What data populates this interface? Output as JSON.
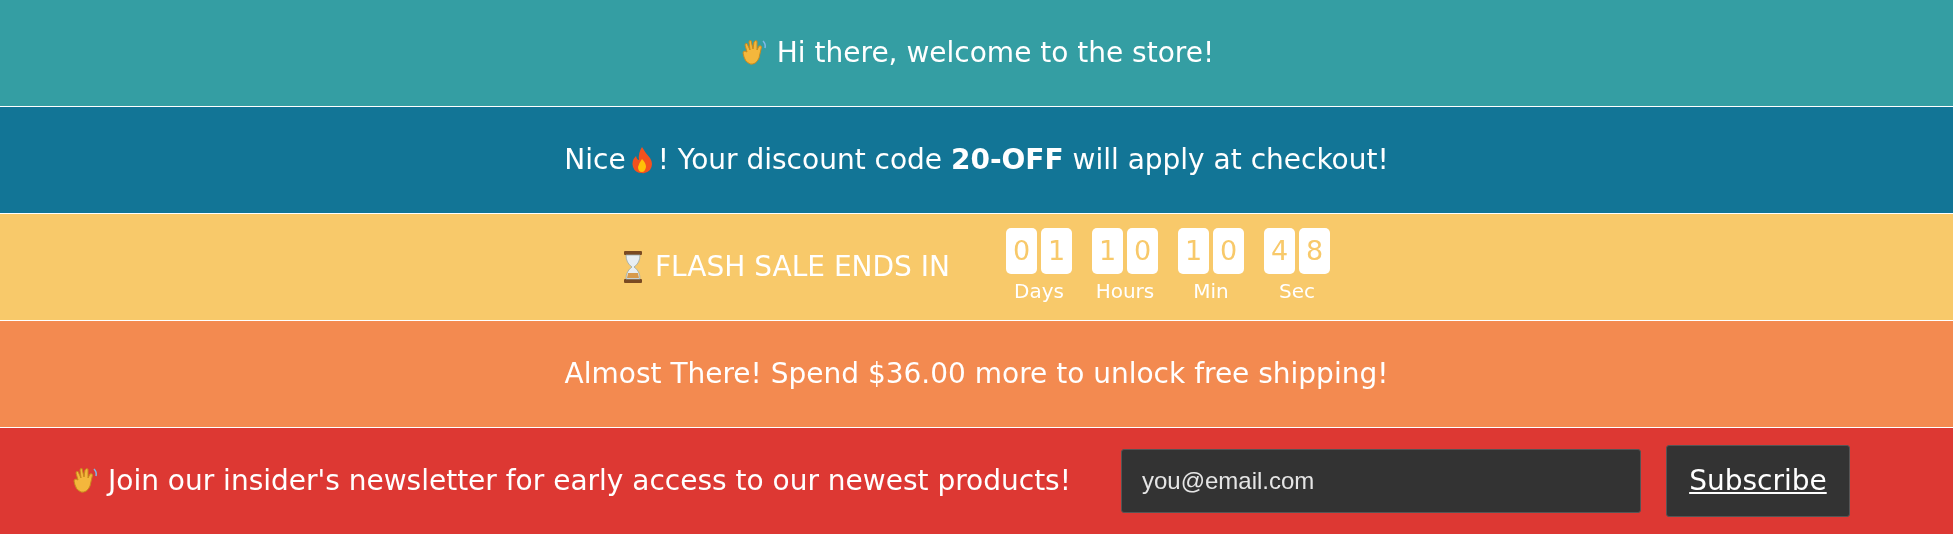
{
  "bars": [
    {
      "kind": "welcome",
      "text": "Hi there, welcome to the store!"
    },
    {
      "kind": "discount",
      "before": "Nice",
      "text": "! Your discount code **20-OFF** will apply at checkout!"
    },
    {
      "kind": "countdown",
      "text": "FLASH SALE ENDS IN",
      "units": [
        {
          "digits": [
            "0",
            "1"
          ],
          "label": "Days"
        },
        {
          "digits": [
            "1",
            "0"
          ],
          "label": "Hours"
        },
        {
          "digits": [
            "1",
            "0"
          ],
          "label": "Min"
        },
        {
          "digits": [
            "4",
            "8"
          ],
          "label": "Sec"
        }
      ]
    },
    {
      "kind": "shipping",
      "text": "Almost There! Spend $36.00 more to unlock free shipping!"
    },
    {
      "kind": "newsletter",
      "text": "Join our insider's newsletter for early access to our newest products!",
      "placeholder": "you@email.com",
      "button": "Subscribe"
    }
  ]
}
